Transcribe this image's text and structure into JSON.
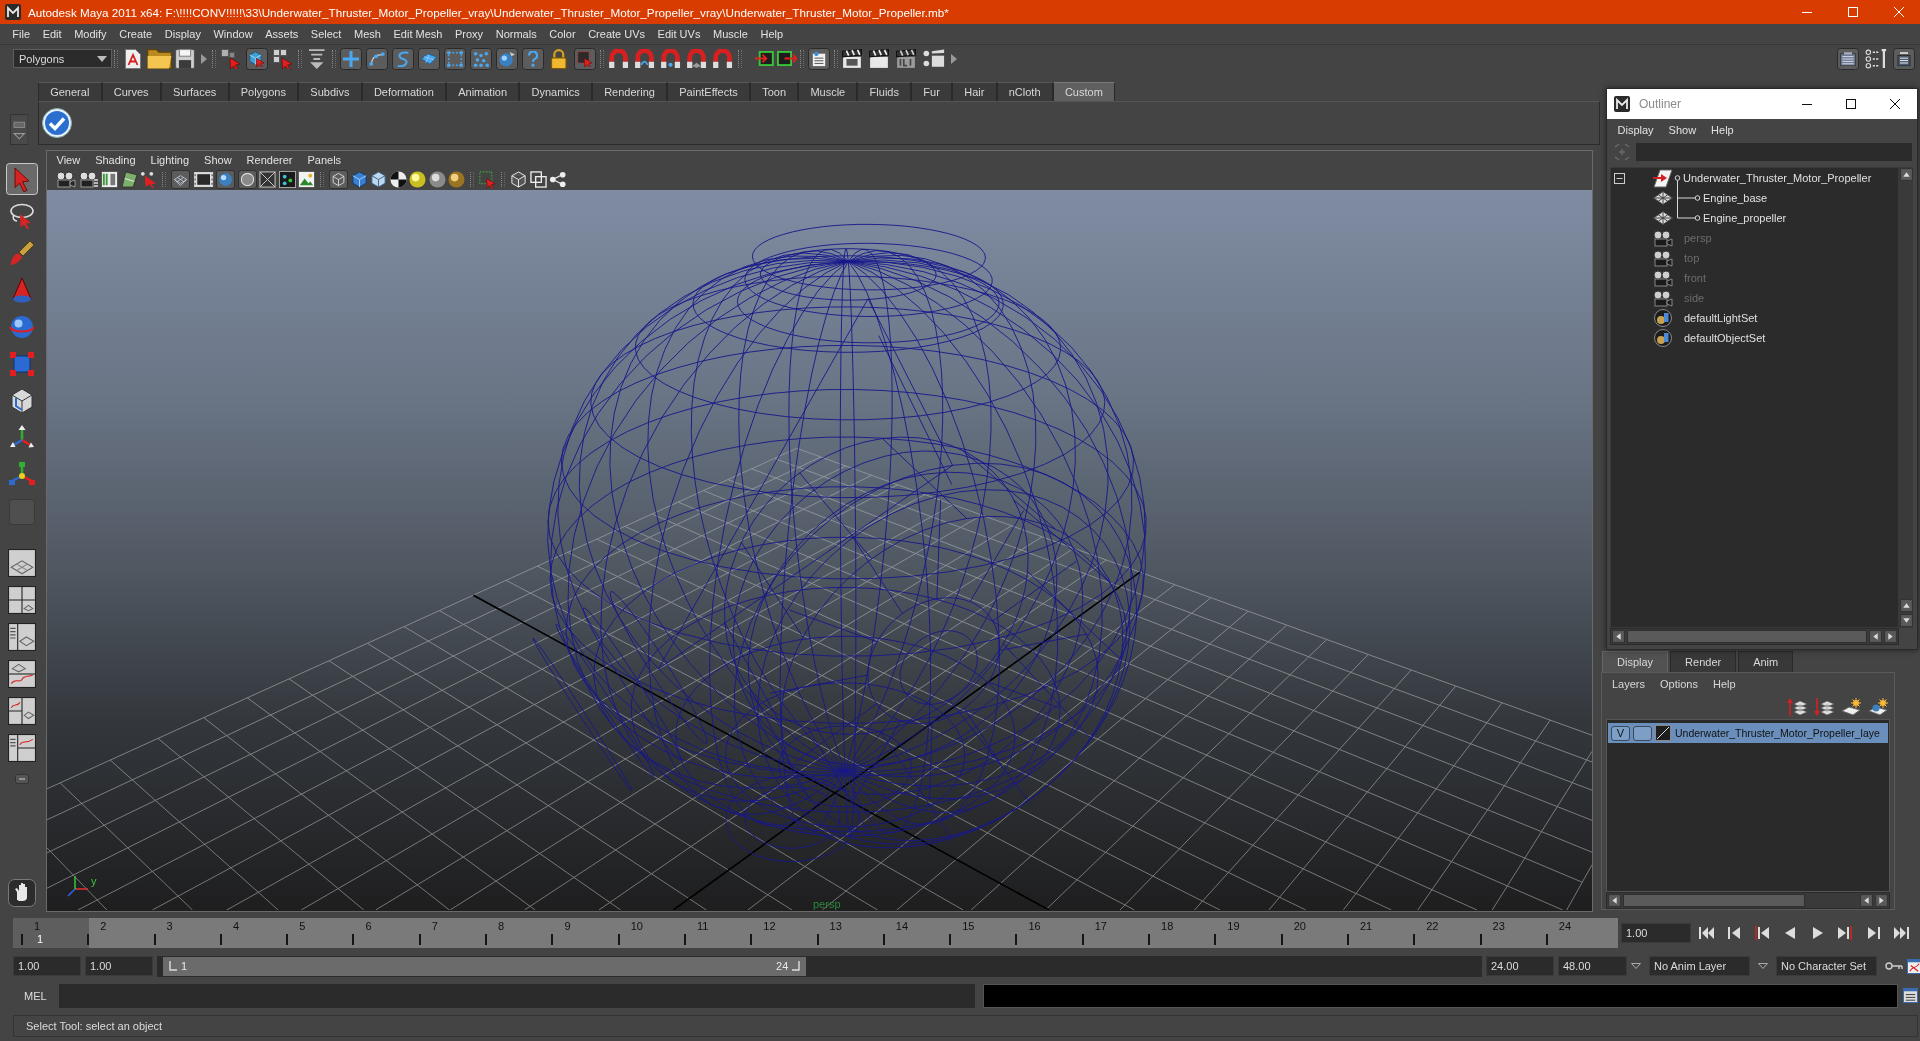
{
  "window": {
    "title": "Autodesk Maya 2011 x64: F:\\!!!!CONV!!!!!\\33\\Underwater_Thruster_Motor_Propeller_vray\\Underwater_Thruster_Motor_Propeller_vray\\Underwater_Thruster_Motor_Propeller.mb*"
  },
  "menu_bar": [
    "File",
    "Edit",
    "Modify",
    "Create",
    "Display",
    "Window",
    "Assets",
    "Select",
    "Mesh",
    "Edit Mesh",
    "Proxy",
    "Normals",
    "Color",
    "Create UVs",
    "Edit UVs",
    "Muscle",
    "Help"
  ],
  "status_line": {
    "menu_set": "Polygons"
  },
  "shelf": {
    "tabs": [
      {
        "label": "General",
        "selected": false
      },
      {
        "label": "Curves",
        "selected": false
      },
      {
        "label": "Surfaces",
        "selected": false
      },
      {
        "label": "Polygons",
        "selected": false
      },
      {
        "label": "Subdivs",
        "selected": false
      },
      {
        "label": "Deformation",
        "selected": false
      },
      {
        "label": "Animation",
        "selected": false
      },
      {
        "label": "Dynamics",
        "selected": false
      },
      {
        "label": "Rendering",
        "selected": false
      },
      {
        "label": "PaintEffects",
        "selected": false
      },
      {
        "label": "Toon",
        "selected": false
      },
      {
        "label": "Muscle",
        "selected": false
      },
      {
        "label": "Fluids",
        "selected": false
      },
      {
        "label": "Fur",
        "selected": false
      },
      {
        "label": "Hair",
        "selected": false
      },
      {
        "label": "nCloth",
        "selected": false
      },
      {
        "label": "Custom",
        "selected": true
      }
    ]
  },
  "toolbox": {
    "tools": [
      {
        "selected": true
      },
      {
        "selected": false
      },
      {
        "selected": false
      },
      {
        "selected": false
      },
      {
        "selected": false
      },
      {
        "selected": false
      },
      {
        "selected": false
      },
      {
        "selected": false
      },
      {
        "selected": false
      },
      {
        "selected": false
      }
    ]
  },
  "viewport": {
    "menu": [
      "View",
      "Shading",
      "Lighting",
      "Show",
      "Renderer",
      "Panels"
    ],
    "axis_label": "y",
    "camera_label": "persp"
  },
  "outliner": {
    "title": "Outliner",
    "menu": [
      "Display",
      "Show",
      "Help"
    ],
    "items": [
      {
        "label": "Underwater_Thruster_Motor_Propeller",
        "kind": "group",
        "dimmed": false,
        "expanded": true,
        "children": [
          {
            "label": "Engine_base",
            "kind": "mesh",
            "dimmed": false
          },
          {
            "label": "Engine_propeller",
            "kind": "mesh",
            "dimmed": false
          }
        ]
      },
      {
        "label": "persp",
        "kind": "camera",
        "dimmed": true
      },
      {
        "label": "top",
        "kind": "camera",
        "dimmed": true
      },
      {
        "label": "front",
        "kind": "camera",
        "dimmed": true
      },
      {
        "label": "side",
        "kind": "camera",
        "dimmed": true
      },
      {
        "label": "defaultLightSet",
        "kind": "set",
        "dimmed": false
      },
      {
        "label": "defaultObjectSet",
        "kind": "set",
        "dimmed": false
      }
    ]
  },
  "layer_editor": {
    "tabs": [
      {
        "label": "Display",
        "selected": true
      },
      {
        "label": "Render",
        "selected": false
      },
      {
        "label": "Anim",
        "selected": false
      }
    ],
    "menu": [
      "Layers",
      "Options",
      "Help"
    ],
    "layers": [
      {
        "visibility": "V",
        "name": "Underwater_Thruster_Motor_Propeller_laye",
        "selected": true
      }
    ]
  },
  "time_slider": {
    "ticks": [
      {
        "label": "1",
        "selected": true
      },
      {
        "label": "2",
        "selected": false
      },
      {
        "label": "3",
        "selected": false
      },
      {
        "label": "4",
        "selected": false
      },
      {
        "label": "5",
        "selected": false
      },
      {
        "label": "6",
        "selected": false
      },
      {
        "label": "7",
        "selected": false
      },
      {
        "label": "8",
        "selected": false
      },
      {
        "label": "9",
        "selected": false
      },
      {
        "label": "10",
        "selected": false
      },
      {
        "label": "11",
        "selected": false
      },
      {
        "label": "12",
        "selected": false
      },
      {
        "label": "13",
        "selected": false
      },
      {
        "label": "14",
        "selected": false
      },
      {
        "label": "15",
        "selected": false
      },
      {
        "label": "16",
        "selected": false
      },
      {
        "label": "17",
        "selected": false
      },
      {
        "label": "18",
        "selected": false
      },
      {
        "label": "19",
        "selected": false
      },
      {
        "label": "20",
        "selected": false
      },
      {
        "label": "21",
        "selected": false
      },
      {
        "label": "22",
        "selected": false
      },
      {
        "label": "23",
        "selected": false
      },
      {
        "label": "24",
        "selected": false
      }
    ],
    "current_frame": "1",
    "current_time": "1.00"
  },
  "range_slider": {
    "start_time": "1.00",
    "range_start": "1.00",
    "handle_start": "1",
    "handle_end": "24",
    "level": 0.49,
    "range_end": "24.00",
    "end_time": "48.00",
    "anim_layer": "No Anim Layer",
    "character_set": "No Character Set"
  },
  "command_line": {
    "language": "MEL"
  },
  "help_line": "Select Tool: select an object"
}
